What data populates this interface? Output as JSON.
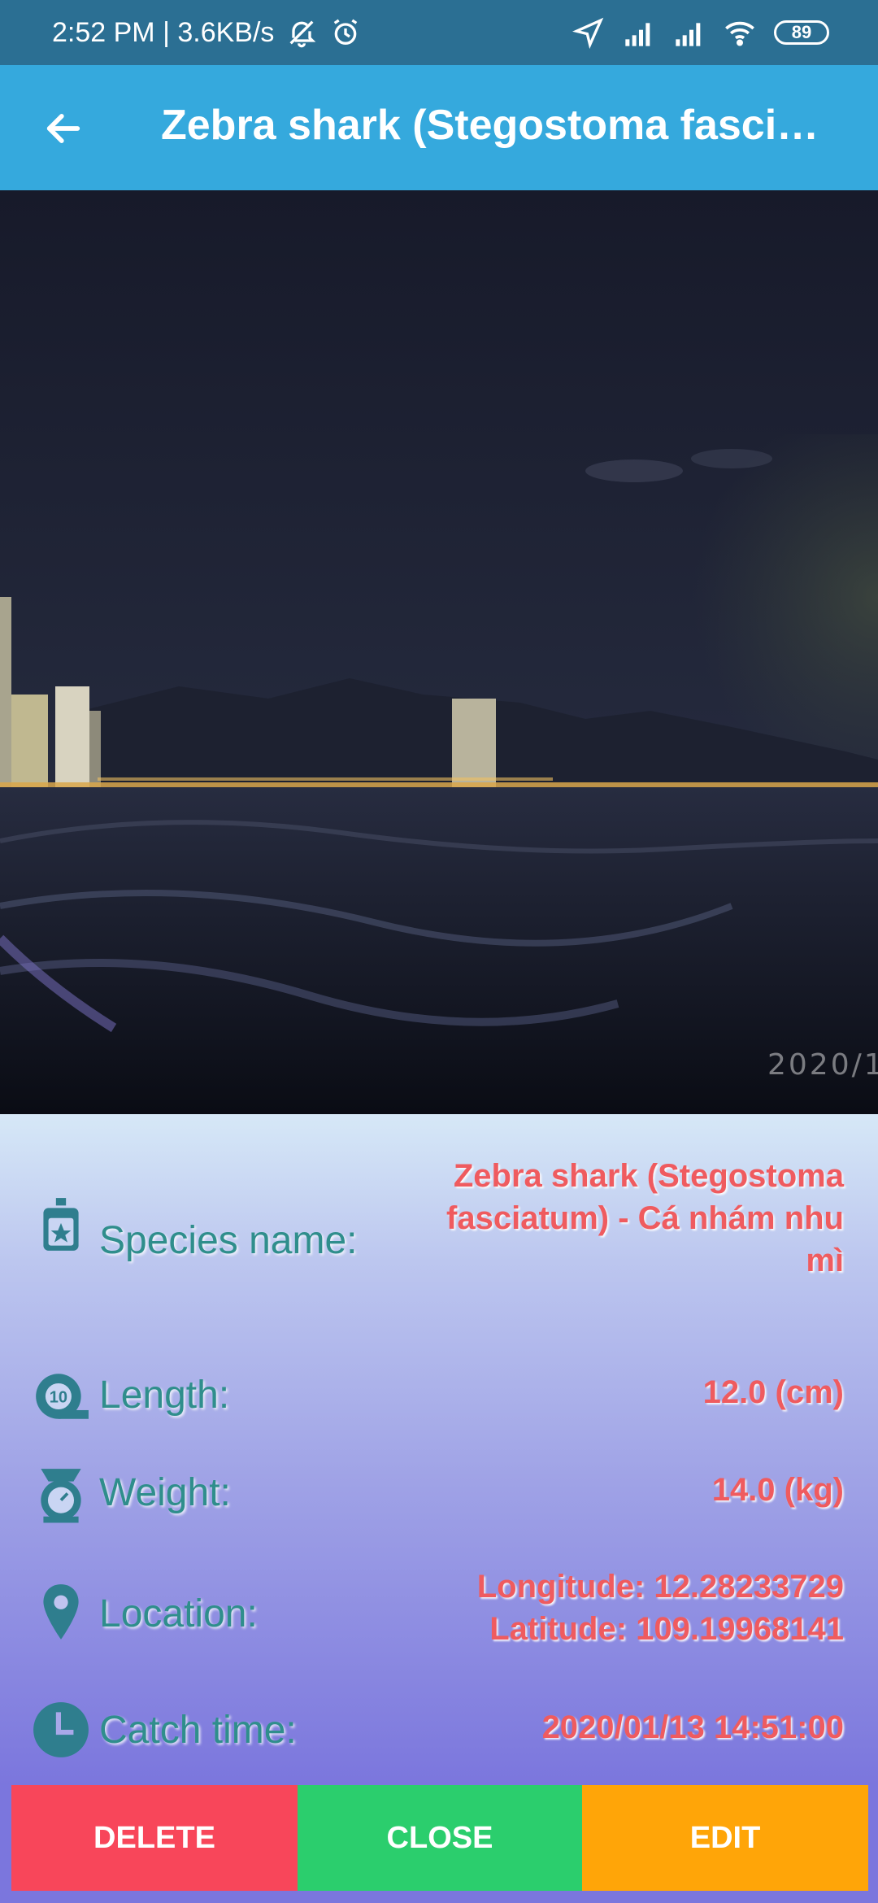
{
  "status_bar": {
    "time_speed": "2:52 PM | 3.6KB/s",
    "battery": "89",
    "icons": [
      "bell-off-icon",
      "alarm-icon",
      "location-arrow-icon",
      "signal-icon",
      "signal-icon",
      "wifi-icon",
      "battery-icon"
    ]
  },
  "app_bar": {
    "title": "Zebra shark (Stegostoma fasci…",
    "back_icon": "arrow-left-icon"
  },
  "photo": {
    "stamp": "2020/1/"
  },
  "details": {
    "species": {
      "label": "Species name:",
      "value_line1": "Zebra shark (Stegostoma",
      "value_line2": "fasciatum) - Cá nhám nhu",
      "value_line3": "mì",
      "icon": "fish-tag-icon"
    },
    "length": {
      "label": "Length:",
      "value": "12.0 (cm)",
      "icon": "tape-measure-icon"
    },
    "weight": {
      "label": "Weight:",
      "value": "14.0 (kg)",
      "icon": "scale-icon"
    },
    "location": {
      "label": "Location:",
      "value_line1": "Longitude: 12.28233729",
      "value_line2": "Latitude: 109.19968141",
      "icon": "map-pin-icon"
    },
    "catch_time": {
      "label": "Catch time:",
      "value": "2020/01/13 14:51:00",
      "icon": "clock-icon"
    }
  },
  "buttons": {
    "delete": "DELETE",
    "close": "CLOSE",
    "edit": "EDIT"
  },
  "colors": {
    "status_bar": "#2b6f93",
    "app_bar": "#35a9dd",
    "label": "#2f8e8c",
    "value": "#ef5b5f",
    "delete": "#f8465a",
    "close": "#2bce6d",
    "edit": "#ffa508"
  }
}
